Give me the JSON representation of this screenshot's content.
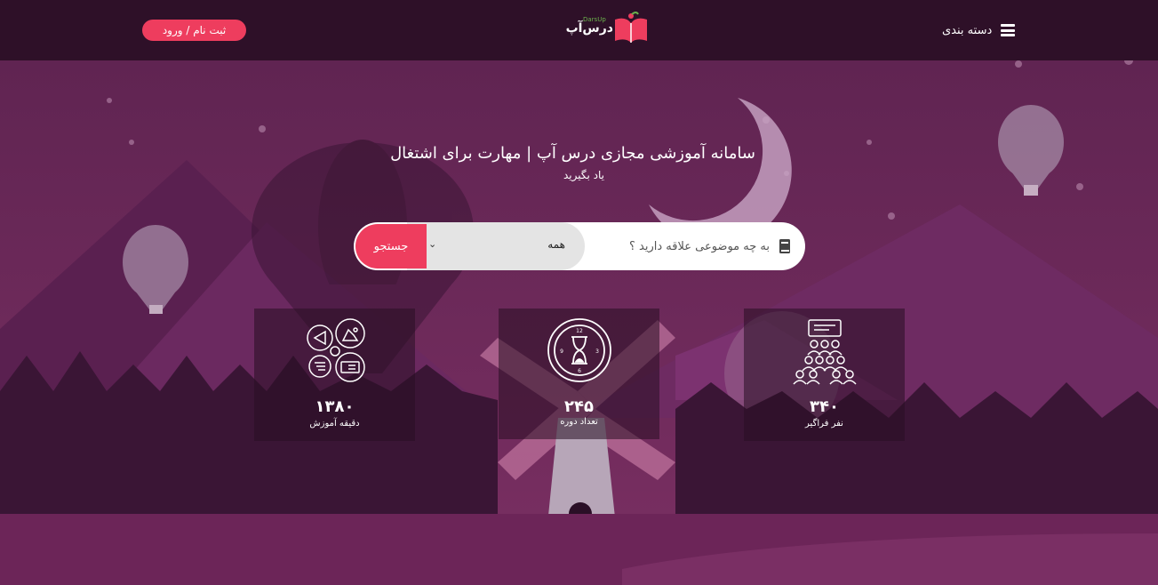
{
  "header": {
    "register_label": "ثبت نام / ورود",
    "menu_label": "دسته بندی",
    "logo_text": "درس‌آپ",
    "logo_subtext": "DarsUp"
  },
  "hero": {
    "title": "سامانه آموزشی مجازی درس آپ | مهارت برای اشتغال",
    "subtitle": "یاد بگیرید"
  },
  "search": {
    "placeholder": "به چه موضوعی علاقه دارید ؟",
    "category_value": "همه",
    "button_label": "جستجو"
  },
  "stats": [
    {
      "value": "۱۳۸۰",
      "label": "دقیقه آموزش",
      "icon": "media-icon"
    },
    {
      "value": "۲۴۵",
      "label": "تعداد دوره",
      "icon": "hourglass-clock-icon"
    },
    {
      "value": "۳۴۰",
      "label": "نفر فراگیر",
      "icon": "audience-icon"
    }
  ],
  "colors": {
    "accent": "#ee3d5e",
    "topbar": "#2e1028",
    "background": "#4a1b3e"
  }
}
